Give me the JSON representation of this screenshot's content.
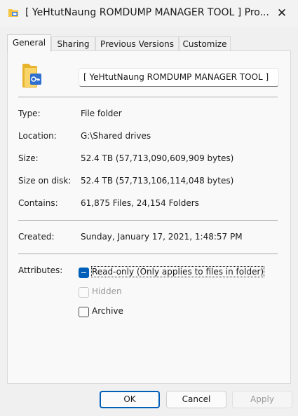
{
  "window": {
    "title": "[ YeHtutNaung ROMDUMP MANAGER TOOL ] Pro...",
    "title_icon": "folder-icon",
    "close_icon": "close-icon",
    "close_glyph": "✕"
  },
  "tabs": [
    {
      "label": "General",
      "active": true
    },
    {
      "label": "Sharing",
      "active": false
    },
    {
      "label": "Previous Versions",
      "active": false
    },
    {
      "label": "Customize",
      "active": false
    }
  ],
  "general": {
    "folder_name": "[ YeHtutNaung ROMDUMP MANAGER TOOL ]",
    "type_label": "Type:",
    "type_value": "File folder",
    "location_label": "Location:",
    "location_value": "G:\\Shared drives",
    "size_label": "Size:",
    "size_value": "52.4 TB (57,713,090,609,909 bytes)",
    "size_on_disk_label": "Size on disk:",
    "size_on_disk_value": "52.4 TB (57,713,106,114,048 bytes)",
    "contains_label": "Contains:",
    "contains_value": "61,875 Files, 24,154 Folders",
    "created_label": "Created:",
    "created_value": "Sunday, January 17, 2021, 1:48:57 PM",
    "attributes_label": "Attributes:",
    "attributes": [
      {
        "label": "Read-only (Only applies to files in folder)",
        "state": "indeterminate",
        "enabled": true
      },
      {
        "label": "Hidden",
        "state": "unchecked",
        "enabled": false
      },
      {
        "label": "Archive",
        "state": "unchecked",
        "enabled": true
      }
    ]
  },
  "buttons": {
    "ok": "OK",
    "cancel": "Cancel",
    "apply": "Apply"
  },
  "colors": {
    "accent": "#005fb8",
    "folder": "#f5c542"
  }
}
